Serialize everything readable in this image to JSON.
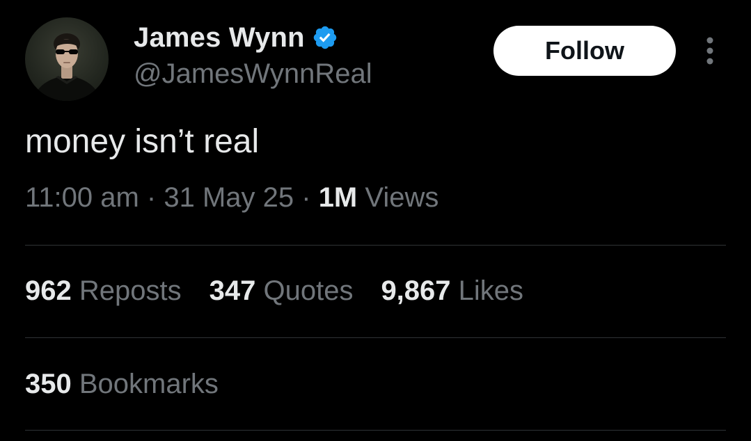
{
  "author": {
    "display_name": "James Wynn",
    "handle": "@JamesWynnReal",
    "verified": true,
    "verified_color": "#1d9bf0"
  },
  "follow_button": {
    "label": "Follow"
  },
  "more_icon": "more-vertical-icon",
  "tweet": {
    "text": "money isn’t real"
  },
  "meta": {
    "time": "11:00 am",
    "separator": " · ",
    "date": "31 May 25",
    "views_count": "1M",
    "views_label": " Views"
  },
  "stats": {
    "reposts": {
      "count": "962",
      "label": " Reposts"
    },
    "quotes": {
      "count": "347",
      "label": " Quotes"
    },
    "likes": {
      "count": "9,867",
      "label": " Likes"
    },
    "bookmarks": {
      "count": "350",
      "label": " Bookmarks"
    }
  },
  "colors": {
    "background": "#000000",
    "primary_text": "#e7e9ea",
    "secondary_text": "#71767b",
    "divider": "#2f3336"
  }
}
